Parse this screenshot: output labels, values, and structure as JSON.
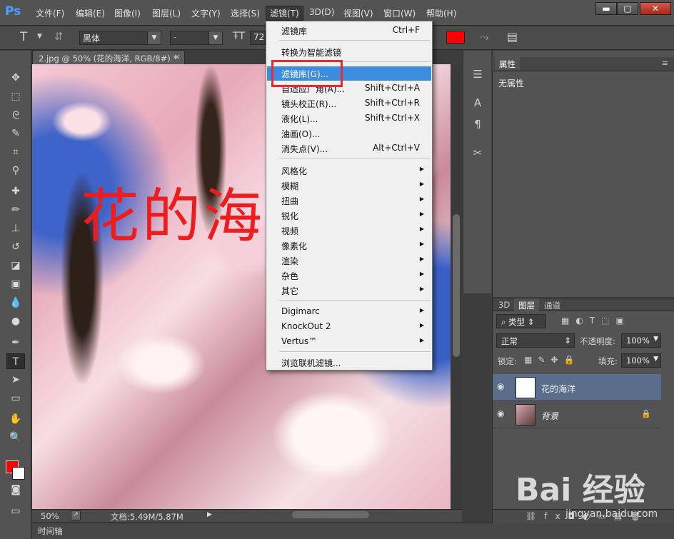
{
  "app": {
    "logo": "Ps"
  },
  "menubar": {
    "items": [
      "文件(F)",
      "编辑(E)",
      "图像(I)",
      "图层(L)",
      "文字(Y)",
      "选择(S)",
      "滤镜(T)",
      "3D(D)",
      "视图(V)",
      "窗口(W)",
      "帮助(H)"
    ],
    "active_index": 6,
    "window_buttons": {
      "minimize": "▬",
      "maximize": "▢",
      "close": "✕"
    }
  },
  "options_bar": {
    "text_tool_glyph": "T",
    "font_family": "黑体",
    "font_style": "-",
    "font_size": "72",
    "text_color": "#ff0000"
  },
  "document": {
    "tab_title": "2.jpg @ 50% (花的海洋, RGB/8#) *",
    "tab_close": "×",
    "canvas_text": "花的海",
    "zoom": "50%",
    "doc_size": "文档:5.49M/5.87M",
    "timeline_label": "时间轴"
  },
  "toolbar": {
    "foreground_color": "#ff0000",
    "background_color": "#ffffff"
  },
  "filter_menu": {
    "items": [
      {
        "label": "滤镜库",
        "shortcut": "Ctrl+F"
      },
      {
        "label": "转换为智能滤镜",
        "shortcut": ""
      },
      {
        "label": "滤镜库(G)...",
        "shortcut": "",
        "highlighted": true
      },
      {
        "label": "自适应广角(A)...",
        "shortcut": "Shift+Ctrl+A"
      },
      {
        "label": "镜头校正(R)...",
        "shortcut": "Shift+Ctrl+R"
      },
      {
        "label": "液化(L)...",
        "shortcut": "Shift+Ctrl+X"
      },
      {
        "label": "油画(O)...",
        "shortcut": ""
      },
      {
        "label": "消失点(V)...",
        "shortcut": "Alt+Ctrl+V"
      },
      {
        "label": "风格化",
        "submenu": true
      },
      {
        "label": "模糊",
        "submenu": true
      },
      {
        "label": "扭曲",
        "submenu": true
      },
      {
        "label": "锐化",
        "submenu": true
      },
      {
        "label": "视频",
        "submenu": true
      },
      {
        "label": "像素化",
        "submenu": true
      },
      {
        "label": "渲染",
        "submenu": true
      },
      {
        "label": "杂色",
        "submenu": true
      },
      {
        "label": "其它",
        "submenu": true
      },
      {
        "label": "Digimarc",
        "submenu": true
      },
      {
        "label": "KnockOut 2",
        "submenu": true
      },
      {
        "label": "Vertus™",
        "submenu": true
      },
      {
        "label": "浏览联机滤镜...",
        "shortcut": ""
      }
    ]
  },
  "properties_panel": {
    "tab": "属性",
    "content": "无属性"
  },
  "layers_panel": {
    "tabs": [
      "3D",
      "图层",
      "通道"
    ],
    "selected_tab": "图层",
    "filter_kind": "类型",
    "blend_mode": "正常",
    "opacity_label": "不透明度:",
    "opacity_value": "100%",
    "lock_label": "锁定:",
    "fill_label": "填充:",
    "fill_value": "100%",
    "layers": [
      {
        "name": "花的海洋",
        "selected": true
      },
      {
        "name": "背景",
        "locked": true
      }
    ]
  },
  "watermark": {
    "logo": "Bai 经验",
    "url": "jingyan.baidu.com"
  }
}
